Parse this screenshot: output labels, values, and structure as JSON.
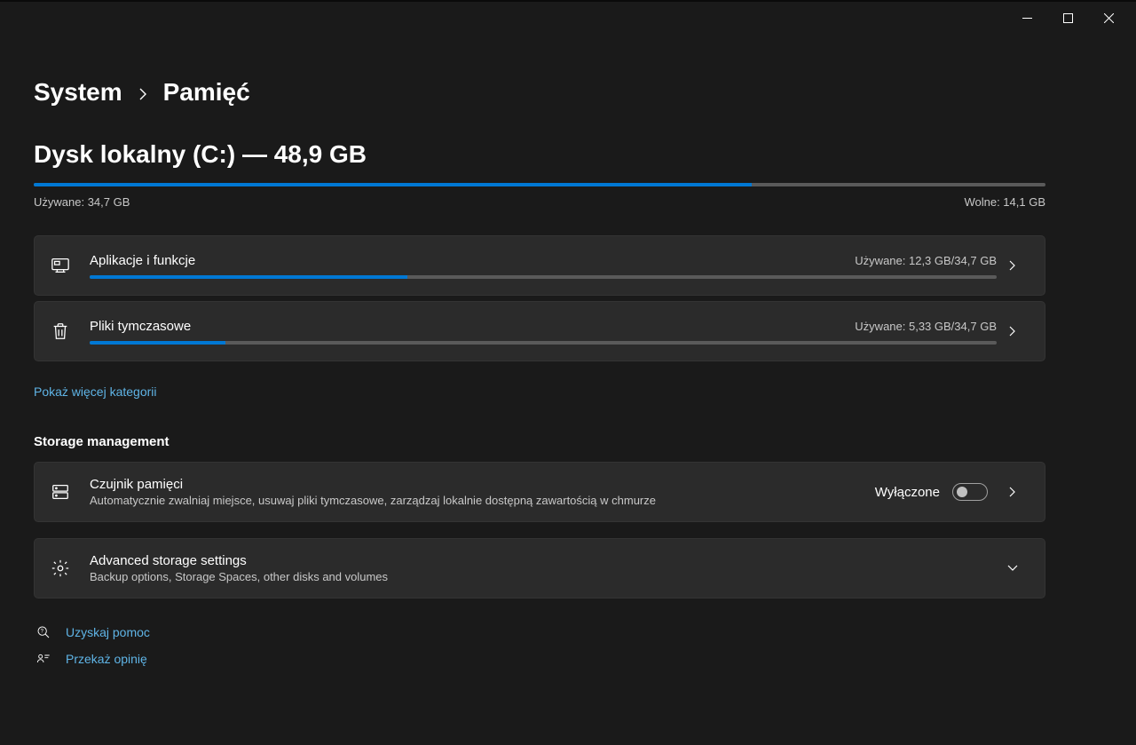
{
  "window": {
    "breadcrumb_root": "System",
    "breadcrumb_leaf": "Pamięć"
  },
  "disk": {
    "title": "Dysk lokalny (C:) — 48,9 GB",
    "used_label": "Używane: 34,7 GB",
    "free_label": "Wolne: 14,1 GB",
    "used_percent": 71
  },
  "categories": [
    {
      "name": "Aplikacje i funkcje",
      "usage": "Używane: 12,3 GB/34,7 GB",
      "percent": 35
    },
    {
      "name": "Pliki tymczasowe",
      "usage": "Używane: 5,33 GB/34,7 GB",
      "percent": 15
    }
  ],
  "more_categories": "Pokaż więcej kategorii",
  "management": {
    "header": "Storage management",
    "sense": {
      "title": "Czujnik pamięci",
      "subtitle": "Automatycznie zwalniaj miejsce, usuwaj pliki tymczasowe, zarządzaj lokalnie dostępną zawartością w chmurze",
      "toggle_label": "Wyłączone"
    },
    "advanced": {
      "title": "Advanced storage settings",
      "subtitle": "Backup options, Storage Spaces, other disks and volumes"
    }
  },
  "footer": {
    "help": "Uzyskaj pomoc",
    "feedback": "Przekaż opinię"
  }
}
